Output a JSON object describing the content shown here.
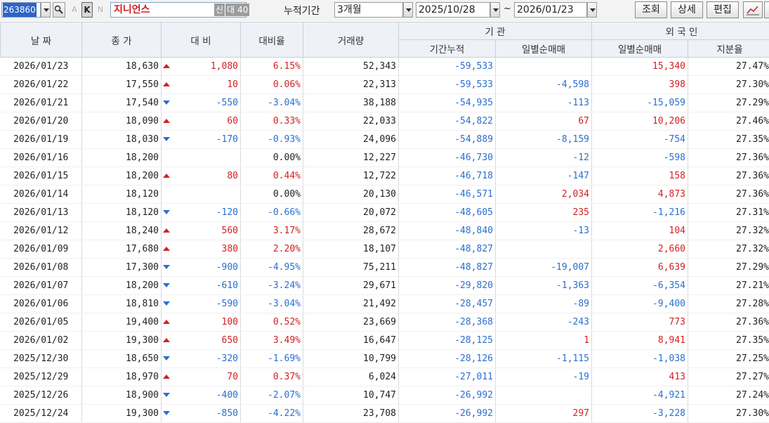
{
  "toolbar": {
    "stock_code": "263860",
    "letter_a": "A",
    "letter_k": "K",
    "letter_n": "N",
    "stock_name": "지니언스",
    "badge_new": "신",
    "badge_loan": "대",
    "badge_num": "40",
    "period_label": "누적기간",
    "period_value": "3개월",
    "date_from": "2025/10/28",
    "tilde": "~",
    "date_to": "2026/01/23",
    "btn_query": "조회",
    "btn_detail": "상세",
    "btn_edit": "편집"
  },
  "headers": {
    "date": "날 짜",
    "close": "종 가",
    "change": "대 비",
    "change_rate": "대비율",
    "volume": "거래량",
    "institution": "기 관",
    "inst_cum": "기간누적",
    "inst_daily": "일별순매매",
    "foreign": "외 국 인",
    "foreign_daily": "일별순매매",
    "foreign_share": "지분율"
  },
  "colors": {
    "up": "#d42020",
    "down": "#2a6fd0",
    "neutral": "#222222"
  },
  "rows": [
    {
      "date": "2026/01/23",
      "close": "18,630",
      "dir": "up",
      "change": "1,080",
      "rate": "6.15%",
      "volume": "52,343",
      "inst_cum": "-59,533",
      "inst_daily": "",
      "foreign_daily": "15,340",
      "share": "27.47%"
    },
    {
      "date": "2026/01/22",
      "close": "17,550",
      "dir": "up",
      "change": "10",
      "rate": "0.06%",
      "volume": "22,313",
      "inst_cum": "-59,533",
      "inst_daily": "-4,598",
      "foreign_daily": "398",
      "share": "27.30%"
    },
    {
      "date": "2026/01/21",
      "close": "17,540",
      "dir": "down",
      "change": "-550",
      "rate": "-3.04%",
      "volume": "38,188",
      "inst_cum": "-54,935",
      "inst_daily": "-113",
      "foreign_daily": "-15,059",
      "share": "27.29%"
    },
    {
      "date": "2026/01/20",
      "close": "18,090",
      "dir": "up",
      "change": "60",
      "rate": "0.33%",
      "volume": "22,033",
      "inst_cum": "-54,822",
      "inst_daily": "67",
      "foreign_daily": "10,206",
      "share": "27.46%"
    },
    {
      "date": "2026/01/19",
      "close": "18,030",
      "dir": "down",
      "change": "-170",
      "rate": "-0.93%",
      "volume": "24,096",
      "inst_cum": "-54,889",
      "inst_daily": "-8,159",
      "foreign_daily": "-754",
      "share": "27.35%"
    },
    {
      "date": "2026/01/16",
      "close": "18,200",
      "dir": "flat",
      "change": "",
      "rate": "0.00%",
      "volume": "12,227",
      "inst_cum": "-46,730",
      "inst_daily": "-12",
      "foreign_daily": "-598",
      "share": "27.36%"
    },
    {
      "date": "2026/01/15",
      "close": "18,200",
      "dir": "up",
      "change": "80",
      "rate": "0.44%",
      "volume": "12,722",
      "inst_cum": "-46,718",
      "inst_daily": "-147",
      "foreign_daily": "158",
      "share": "27.36%"
    },
    {
      "date": "2026/01/14",
      "close": "18,120",
      "dir": "flat",
      "change": "",
      "rate": "0.00%",
      "volume": "20,130",
      "inst_cum": "-46,571",
      "inst_daily": "2,034",
      "foreign_daily": "4,873",
      "share": "27.36%"
    },
    {
      "date": "2026/01/13",
      "close": "18,120",
      "dir": "down",
      "change": "-120",
      "rate": "-0.66%",
      "volume": "20,072",
      "inst_cum": "-48,605",
      "inst_daily": "235",
      "foreign_daily": "-1,216",
      "share": "27.31%"
    },
    {
      "date": "2026/01/12",
      "close": "18,240",
      "dir": "up",
      "change": "560",
      "rate": "3.17%",
      "volume": "28,672",
      "inst_cum": "-48,840",
      "inst_daily": "-13",
      "foreign_daily": "104",
      "share": "27.32%"
    },
    {
      "date": "2026/01/09",
      "close": "17,680",
      "dir": "up",
      "change": "380",
      "rate": "2.20%",
      "volume": "18,107",
      "inst_cum": "-48,827",
      "inst_daily": "",
      "foreign_daily": "2,660",
      "share": "27.32%"
    },
    {
      "date": "2026/01/08",
      "close": "17,300",
      "dir": "down",
      "change": "-900",
      "rate": "-4.95%",
      "volume": "75,211",
      "inst_cum": "-48,827",
      "inst_daily": "-19,007",
      "foreign_daily": "6,639",
      "share": "27.29%"
    },
    {
      "date": "2026/01/07",
      "close": "18,200",
      "dir": "down",
      "change": "-610",
      "rate": "-3.24%",
      "volume": "29,671",
      "inst_cum": "-29,820",
      "inst_daily": "-1,363",
      "foreign_daily": "-6,354",
      "share": "27.21%"
    },
    {
      "date": "2026/01/06",
      "close": "18,810",
      "dir": "down",
      "change": "-590",
      "rate": "-3.04%",
      "volume": "21,492",
      "inst_cum": "-28,457",
      "inst_daily": "-89",
      "foreign_daily": "-9,400",
      "share": "27.28%"
    },
    {
      "date": "2026/01/05",
      "close": "19,400",
      "dir": "up",
      "change": "100",
      "rate": "0.52%",
      "volume": "23,669",
      "inst_cum": "-28,368",
      "inst_daily": "-243",
      "foreign_daily": "773",
      "share": "27.36%"
    },
    {
      "date": "2026/01/02",
      "close": "19,300",
      "dir": "up",
      "change": "650",
      "rate": "3.49%",
      "volume": "16,647",
      "inst_cum": "-28,125",
      "inst_daily": "1",
      "foreign_daily": "8,941",
      "share": "27.35%"
    },
    {
      "date": "2025/12/30",
      "close": "18,650",
      "dir": "down",
      "change": "-320",
      "rate": "-1.69%",
      "volume": "10,799",
      "inst_cum": "-28,126",
      "inst_daily": "-1,115",
      "foreign_daily": "-1,038",
      "share": "27.25%"
    },
    {
      "date": "2025/12/29",
      "close": "18,970",
      "dir": "up",
      "change": "70",
      "rate": "0.37%",
      "volume": "6,024",
      "inst_cum": "-27,011",
      "inst_daily": "-19",
      "foreign_daily": "413",
      "share": "27.27%"
    },
    {
      "date": "2025/12/26",
      "close": "18,900",
      "dir": "down",
      "change": "-400",
      "rate": "-2.07%",
      "volume": "10,747",
      "inst_cum": "-26,992",
      "inst_daily": "",
      "foreign_daily": "-4,921",
      "share": "27.24%"
    },
    {
      "date": "2025/12/24",
      "close": "19,300",
      "dir": "down",
      "change": "-850",
      "rate": "-4.22%",
      "volume": "23,708",
      "inst_cum": "-26,992",
      "inst_daily": "297",
      "foreign_daily": "-3,228",
      "share": "27.30%"
    }
  ]
}
